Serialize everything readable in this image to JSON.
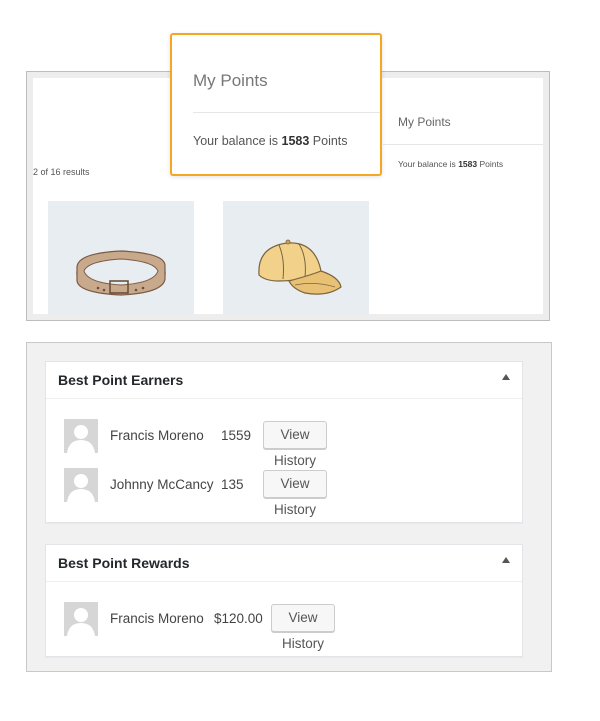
{
  "shop": {
    "results_text": "2 of 16 results",
    "sidebar_widget": {
      "title": "My Points",
      "balance_prefix": "Your balance is ",
      "balance_value": "1583",
      "balance_suffix": " Points"
    },
    "products": [
      {
        "name": "belt",
        "icon": "belt-icon"
      },
      {
        "name": "cap",
        "icon": "cap-icon"
      }
    ]
  },
  "popup": {
    "title": "My Points",
    "balance_prefix": "Your balance is ",
    "balance_value": "1583",
    "balance_suffix": " Points",
    "highlight_color": "#f5a623"
  },
  "earners": {
    "title": "Best Point Earners",
    "rows": [
      {
        "name": "Francis Moreno",
        "score": "1559",
        "button": "View History"
      },
      {
        "name": "Johnny McCancy",
        "score": "135",
        "button": "View History"
      }
    ]
  },
  "rewards": {
    "title": "Best Point Rewards",
    "rows": [
      {
        "name": "Francis Moreno",
        "score": "$120.00",
        "button": "View History"
      }
    ]
  }
}
